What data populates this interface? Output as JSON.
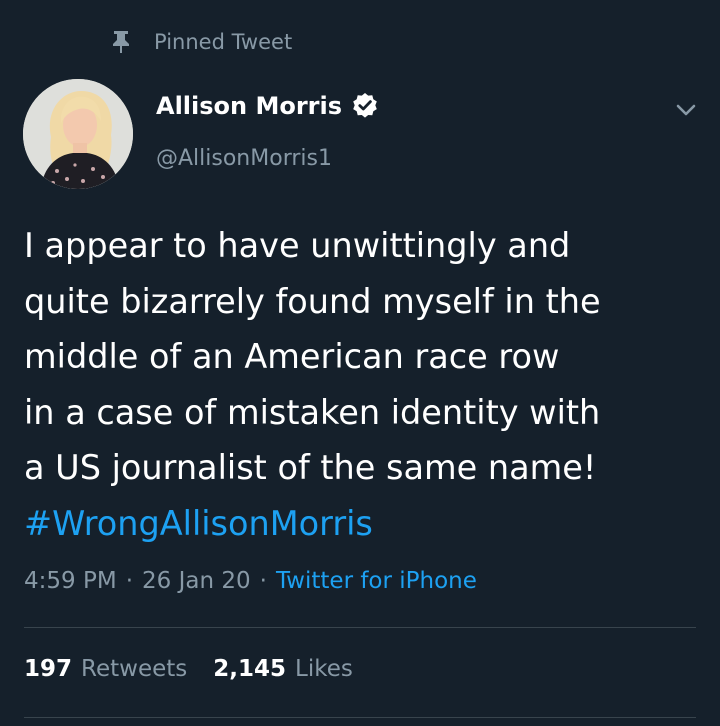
{
  "pinned": {
    "label": "Pinned Tweet",
    "icon": "pin-icon"
  },
  "author": {
    "name": "Allison Morris",
    "handle": "@AllisonMorris1",
    "verified": true,
    "avatar_icon": "avatar-photo"
  },
  "tweet": {
    "lines": [
      "I appear to have unwittingly and",
      "quite bizarrely found myself in the",
      "middle of an American race row",
      "in a case of mistaken identity with",
      "a US journalist of the same name!"
    ],
    "hashtag": "#WrongAllisonMorris"
  },
  "meta": {
    "time": "4:59 PM",
    "date": "26 Jan 20",
    "source": "Twitter for iPhone",
    "separator": "·"
  },
  "stats": {
    "retweets_count": "197",
    "retweets_label": "Retweets",
    "likes_count": "2,145",
    "likes_label": "Likes"
  },
  "colors": {
    "background": "#15202b",
    "accent": "#1da1f2",
    "secondary_text": "#8899a6"
  }
}
